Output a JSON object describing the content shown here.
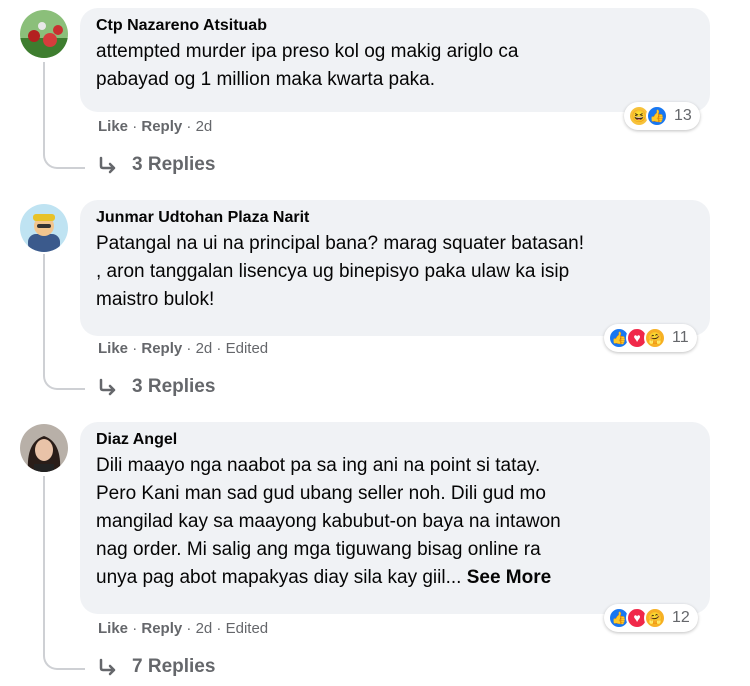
{
  "comments": [
    {
      "author": "Ctp Nazareno Atsituab",
      "text_lines": [
        "attempted murder ipa preso kol og makig ariglo ca",
        "pabayad og 1 million maka kwarta paka."
      ],
      "like_label": "Like",
      "reply_label": "Reply",
      "separator": "·",
      "time": "2d",
      "edited": "",
      "reactions": [
        "haha-icon",
        "like-icon"
      ],
      "reaction_count": "13",
      "replies_label": "3 Replies"
    },
    {
      "author": "Junmar Udtohan Plaza Narit",
      "text_lines": [
        "Patangal na ui na principal bana? marag squater batasan!",
        ", aron tanggalan lisencya ug binepisyo paka ulaw ka isip",
        "maistro bulok!"
      ],
      "like_label": "Like",
      "reply_label": "Reply",
      "separator": "·",
      "time": "2d",
      "edited": "Edited",
      "reactions": [
        "like-icon",
        "love-icon",
        "care-icon"
      ],
      "reaction_count": "11",
      "replies_label": "3 Replies"
    },
    {
      "author": "Diaz Angel",
      "text_lines": [
        "Dili maayo nga naabot pa sa ing ani na point si tatay.",
        "Pero Kani man sad gud ubang seller noh. Dili gud mo",
        "mangilad kay sa maayong kabubut-on baya na intawon",
        "nag order. Mi salig ang mga tiguwang bisag online ra",
        "unya pag abot mapakyas diay sila kay giil..."
      ],
      "see_more": "See More",
      "like_label": "Like",
      "reply_label": "Reply",
      "separator": "·",
      "time": "2d",
      "edited": "Edited",
      "reactions": [
        "like-icon",
        "love-icon",
        "care-icon"
      ],
      "reaction_count": "12",
      "replies_label": "7 Replies"
    }
  ],
  "colors": {
    "bubble": "#f0f2f5",
    "meta_text": "#65676b",
    "like_blue": "#1877f2",
    "love_red": "#f02849",
    "haha_yellow": "#f7c23a"
  }
}
